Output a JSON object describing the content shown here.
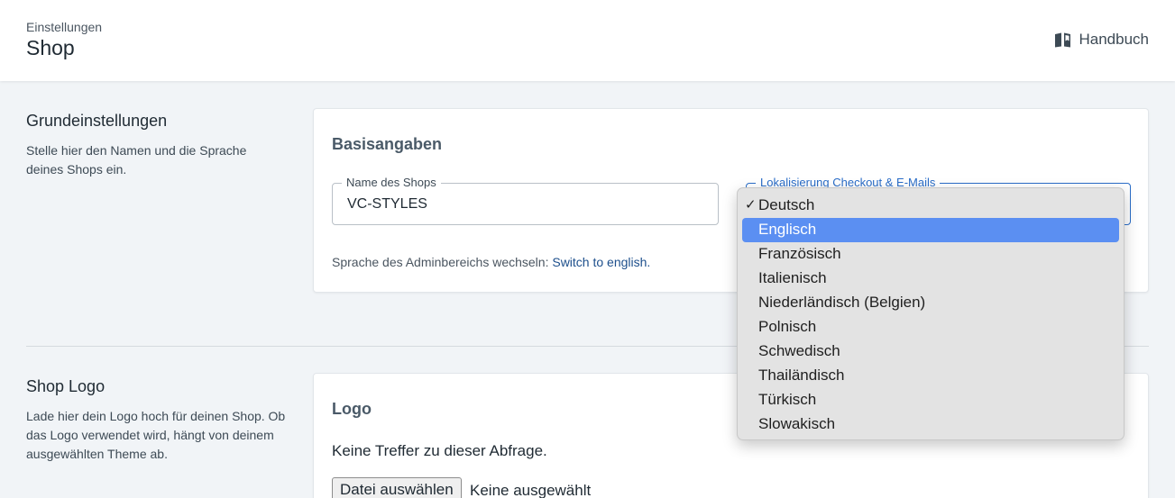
{
  "header": {
    "breadcrumb": "Einstellungen",
    "title": "Shop",
    "manual_label": "Handbuch",
    "manual_icon": "book-icon"
  },
  "basic_settings": {
    "section_title": "Grundeinstellungen",
    "section_desc": "Stelle hier den Namen und die Sprache deines Shops ein.",
    "card_title": "Basisangaben",
    "shop_name_label": "Name des Shops",
    "shop_name_value": "VC-STYLES",
    "localization_label": "Lokalisierung Checkout & E-Mails",
    "admin_language_text": "Sprache des Adminbereichs wechseln:",
    "admin_language_link": "Switch to english."
  },
  "logo_settings": {
    "section_title": "Shop Logo",
    "section_desc": "Lade hier dein Logo hoch für deinen Shop. Ob das Logo verwendet wird, hängt von deinem ausgewählten Theme ab.",
    "card_title": "Logo",
    "no_results": "Keine Treffer zu dieser Abfrage.",
    "file_button": "Datei auswählen",
    "file_status": "Keine ausgewählt"
  },
  "language_dropdown": {
    "selected": "Deutsch",
    "highlighted": "Englisch",
    "options": [
      "Deutsch",
      "Englisch",
      "Französisch",
      "Italienisch",
      "Niederländisch (Belgien)",
      "Polnisch",
      "Schwedisch",
      "Thailändisch",
      "Türkisch",
      "Slowakisch"
    ]
  },
  "colors": {
    "accent": "#2a6dc8",
    "highlight": "#5b8ff2",
    "link": "#1d4f8c"
  }
}
